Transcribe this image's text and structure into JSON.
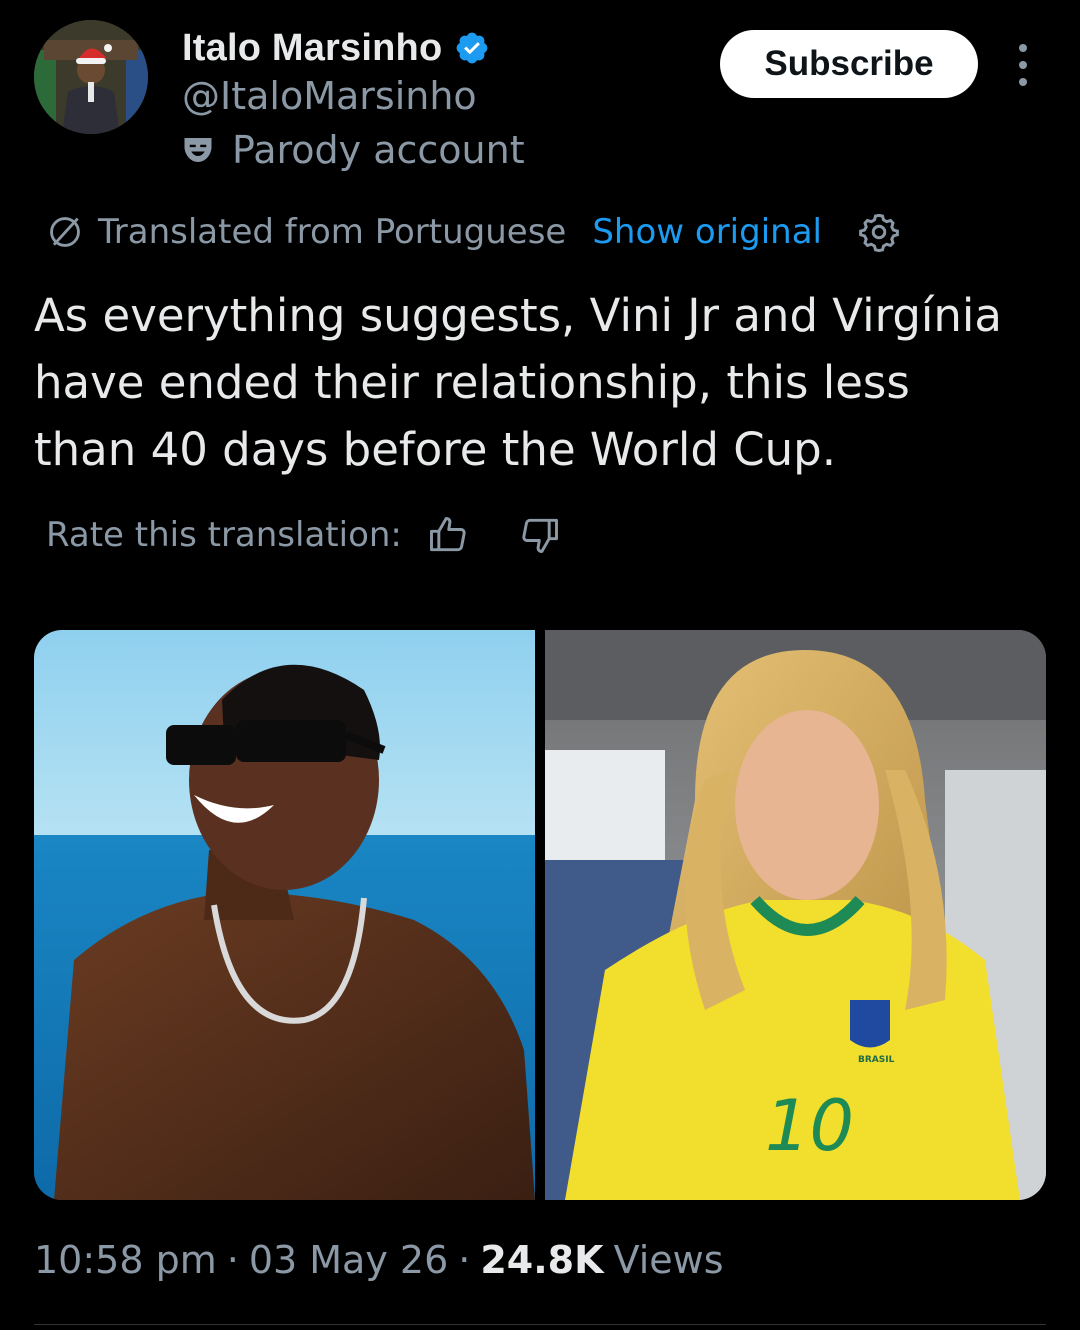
{
  "author": {
    "display_name": "Italo Marsinho",
    "handle": "@ItaloMarsinho",
    "verified": true,
    "label": "Parody account",
    "avatar_icon": "profile-photo"
  },
  "actions": {
    "subscribe_label": "Subscribe",
    "more_icon": "more-vertical-icon"
  },
  "translation": {
    "notice": "Translated from Portuguese",
    "show_original": "Show original",
    "settings_icon": "gear-icon",
    "rate_label": "Rate this translation:"
  },
  "tweet": {
    "text": "As everything suggests, Vini Jr and Virgínia\nhave ended their relationship, this less\nthan 40 days before the World Cup."
  },
  "media": [
    {
      "name": "photo-man-sea"
    },
    {
      "name": "photo-woman-jersey",
      "jersey_text": "BRASIL",
      "jersey_number": "10"
    }
  ],
  "meta": {
    "time": "10:58 pm",
    "separator": "·",
    "date": "03 May 26",
    "views_count": "24.8K",
    "views_label": "Views"
  },
  "colors": {
    "background": "#000000",
    "text": "#e7e9ea",
    "secondary": "#8b98a5",
    "accent": "#1d9bf0"
  }
}
